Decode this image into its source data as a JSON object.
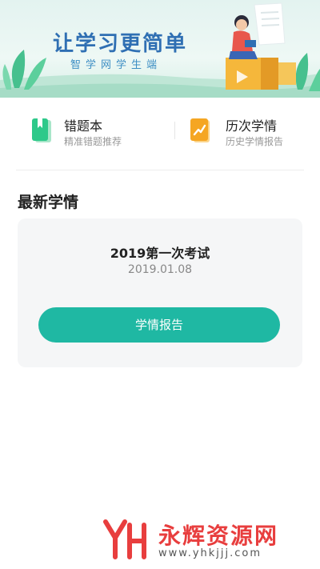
{
  "banner": {
    "title": "让学习更简单",
    "subtitle": "智学网学生端"
  },
  "features": [
    {
      "title": "错题本",
      "subtitle": "精准错题推荐",
      "icon": "notebook-icon",
      "color": "#2ec98a"
    },
    {
      "title": "历次学情",
      "subtitle": "历史学情报告",
      "icon": "trend-chart-icon",
      "color": "#f5a623"
    }
  ],
  "latest": {
    "section_title": "最新学情",
    "exam_name": "2019第一次考试",
    "exam_date": "2019.01.08",
    "button_label": "学情报告"
  },
  "watermark": {
    "brand": "永辉资源网",
    "url": "www.yhkjjj.com"
  },
  "colors": {
    "accent": "#1fb8a3",
    "card_bg": "#f5f6f7",
    "watermark": "#e83e3e"
  }
}
